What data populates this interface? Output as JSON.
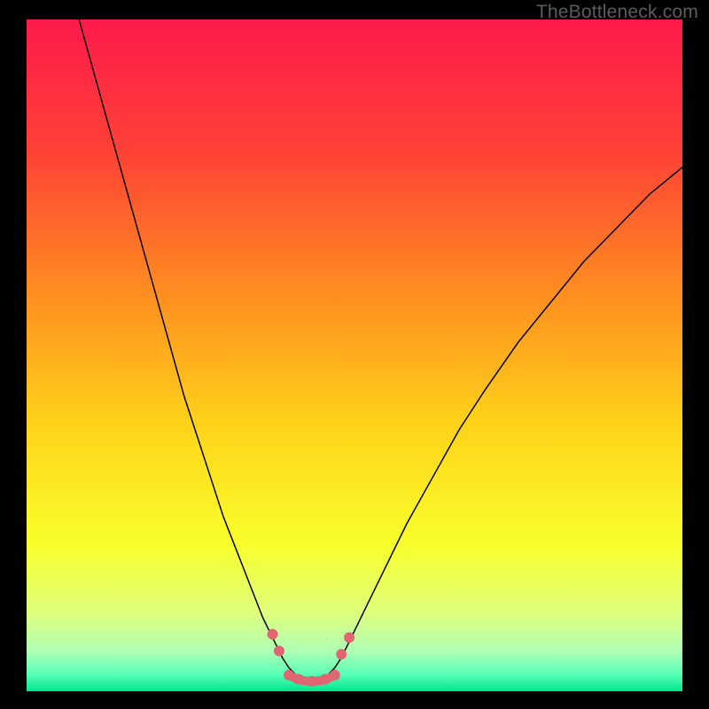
{
  "watermark": "TheBottleneck.com",
  "chart_data": {
    "type": "line",
    "title": "",
    "xlabel": "",
    "ylabel": "",
    "xlim": [
      0,
      100
    ],
    "ylim": [
      0,
      100
    ],
    "grid": false,
    "background_gradient_stops": [
      {
        "offset": 0.0,
        "color": "#ff1a4b"
      },
      {
        "offset": 0.2,
        "color": "#ff4236"
      },
      {
        "offset": 0.4,
        "color": "#ff8b21"
      },
      {
        "offset": 0.6,
        "color": "#ffd21a"
      },
      {
        "offset": 0.78,
        "color": "#f9ff2a"
      },
      {
        "offset": 0.88,
        "color": "#e0ff7a"
      },
      {
        "offset": 0.94,
        "color": "#b0ffb5"
      },
      {
        "offset": 0.975,
        "color": "#57ffb5"
      },
      {
        "offset": 1.0,
        "color": "#00e58e"
      }
    ],
    "series": [
      {
        "name": "left-curve",
        "stroke": "#000000",
        "stroke_width": 1.5,
        "x": [
          8,
          10,
          12,
          14,
          16,
          18,
          20,
          22,
          24,
          26,
          28,
          30,
          32,
          34,
          36,
          37,
          38,
          39,
          40,
          41
        ],
        "y": [
          100,
          93,
          86,
          79,
          72,
          65,
          58,
          51,
          44,
          38,
          32,
          26,
          21,
          16,
          11,
          9,
          7,
          5,
          3.5,
          2.5
        ]
      },
      {
        "name": "right-curve",
        "stroke": "#000000",
        "stroke_width": 1.5,
        "x": [
          46,
          47,
          48,
          49,
          50,
          52,
          55,
          58,
          62,
          66,
          70,
          75,
          80,
          85,
          90,
          95,
          100
        ],
        "y": [
          2.5,
          3.5,
          5,
          7,
          9,
          13,
          19,
          25,
          32,
          39,
          45,
          52,
          58,
          64,
          69,
          74,
          78
        ]
      },
      {
        "name": "valley-floor",
        "stroke": "#e06673",
        "stroke_width": 10,
        "x": [
          40,
          41,
          42,
          43,
          44,
          45,
          46,
          47
        ],
        "y": [
          2.4,
          1.9,
          1.6,
          1.5,
          1.5,
          1.6,
          1.9,
          2.4
        ]
      }
    ],
    "markers": [
      {
        "name": "dot-left-upper",
        "x": 37.5,
        "y": 8.5,
        "r": 6,
        "fill": "#e06673"
      },
      {
        "name": "dot-left-lower",
        "x": 38.5,
        "y": 6.0,
        "r": 6,
        "fill": "#e06673"
      },
      {
        "name": "dot-right-lower",
        "x": 48.0,
        "y": 5.5,
        "r": 6,
        "fill": "#e06673"
      },
      {
        "name": "dot-right-upper",
        "x": 49.2,
        "y": 8.0,
        "r": 6,
        "fill": "#e06673"
      },
      {
        "name": "dot-floor-1",
        "x": 40.0,
        "y": 2.4,
        "r": 6,
        "fill": "#e06673"
      },
      {
        "name": "dot-floor-2",
        "x": 41.5,
        "y": 1.8,
        "r": 6,
        "fill": "#e06673"
      },
      {
        "name": "dot-floor-3",
        "x": 43.5,
        "y": 1.5,
        "r": 6,
        "fill": "#e06673"
      },
      {
        "name": "dot-floor-4",
        "x": 45.5,
        "y": 1.8,
        "r": 6,
        "fill": "#e06673"
      },
      {
        "name": "dot-floor-5",
        "x": 47.0,
        "y": 2.4,
        "r": 6,
        "fill": "#e06673"
      }
    ]
  }
}
